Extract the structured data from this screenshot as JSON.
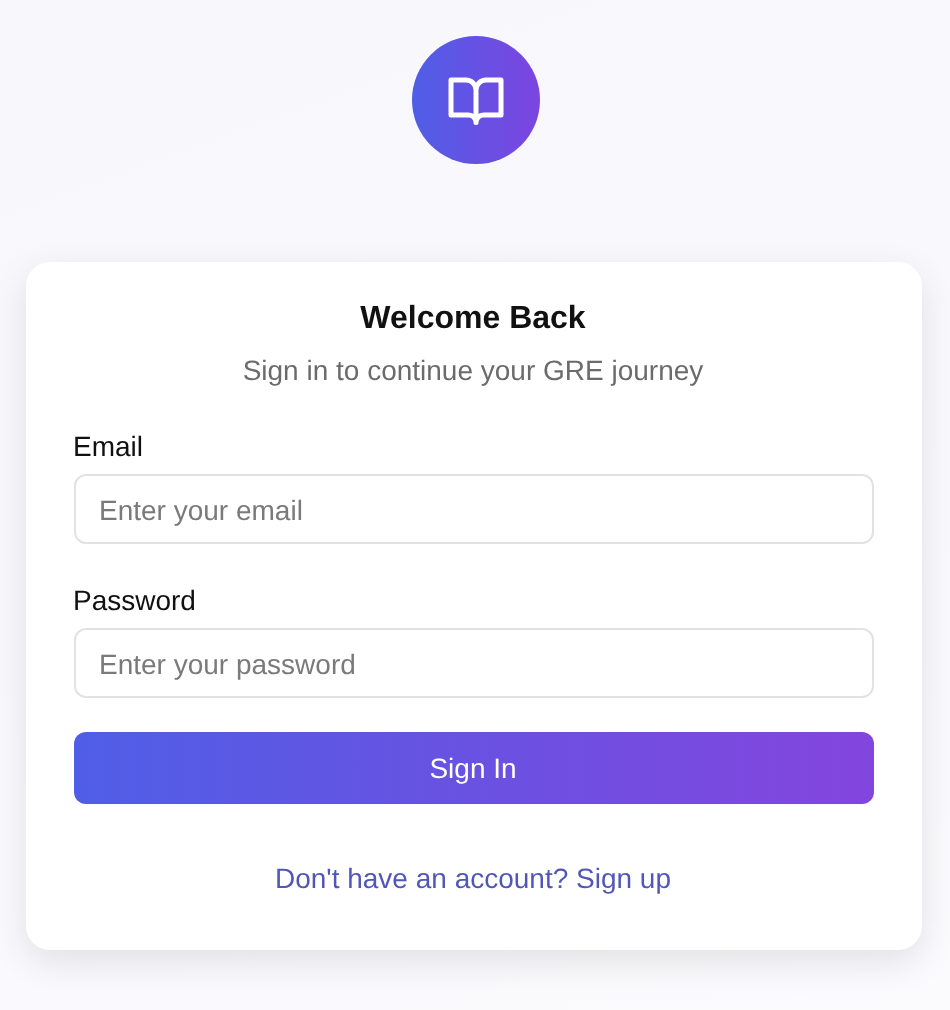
{
  "card": {
    "title": "Welcome Back",
    "subtitle": "Sign in to continue your GRE journey"
  },
  "fields": [
    {
      "label": "Email",
      "placeholder": "Enter your email"
    },
    {
      "label": "Password",
      "placeholder": "Enter your password"
    }
  ],
  "submit_button": "Sign In",
  "signup_link": "Don't have an account? Sign up"
}
